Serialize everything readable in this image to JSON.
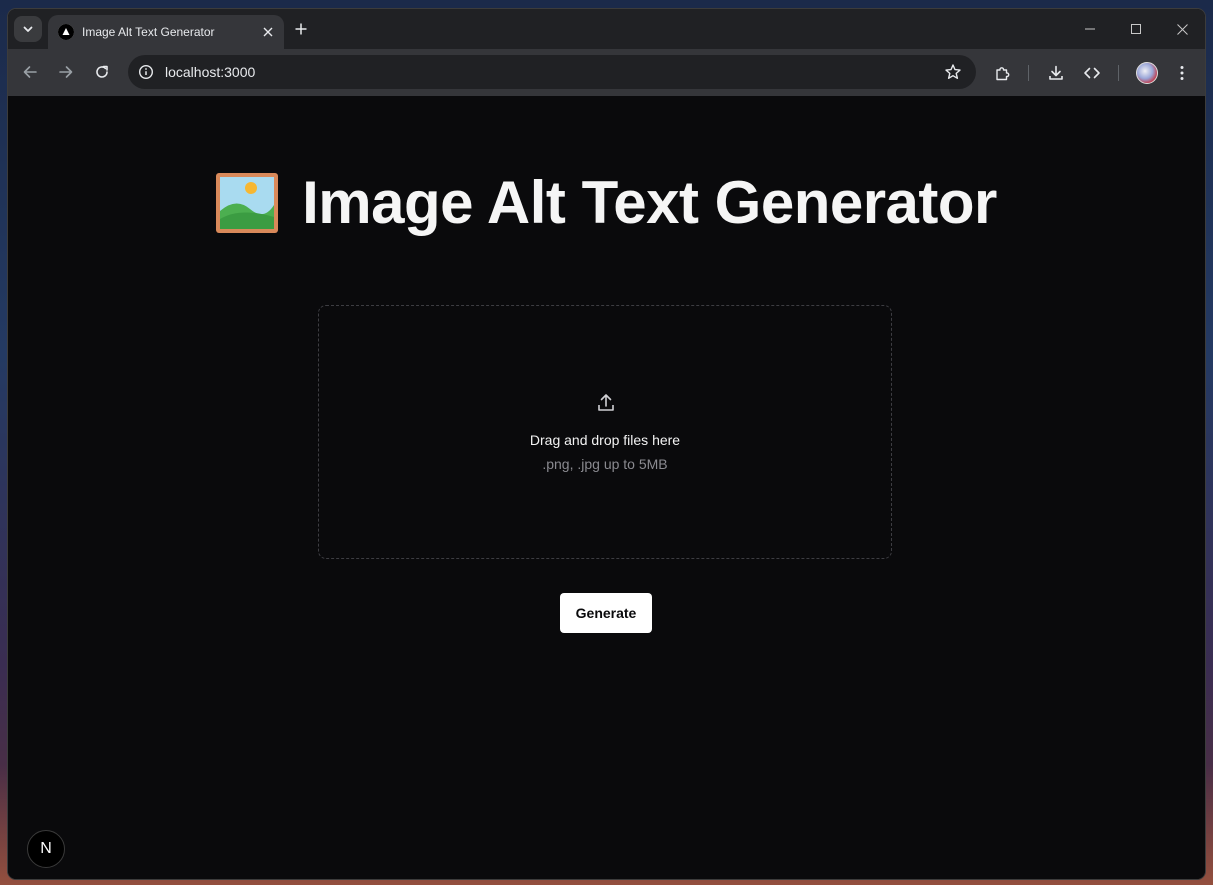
{
  "browser": {
    "tab": {
      "title": "Image Alt Text Generator"
    },
    "address_bar": {
      "url": "localhost:3000"
    },
    "icons": {
      "tab_search": "chevron-down-icon",
      "tab_close": "close-icon",
      "new_tab": "plus-icon",
      "back": "arrow-left-icon",
      "forward": "arrow-right-icon",
      "reload": "reload-icon",
      "site_info": "info-icon",
      "bookmark": "star-icon",
      "extensions": "puzzle-icon",
      "downloads": "download-icon",
      "devtools": "code-icon",
      "menu": "kebab-menu-icon"
    }
  },
  "page": {
    "title": "Image Alt Text Generator",
    "title_icon": "framed-picture-icon",
    "dropzone": {
      "icon": "upload-icon",
      "text": "Drag and drop files here",
      "subtext": ".png, .jpg up to 5MB"
    },
    "generate_label": "Generate",
    "framework_badge": "N"
  },
  "colors": {
    "page_background": "#0a0a0c",
    "title_text": "#f5f5f5",
    "button_background": "#ffffff",
    "button_text": "#0a0a0c",
    "dropzone_border": "#3d3d42",
    "subtext": "#8a8a90"
  }
}
